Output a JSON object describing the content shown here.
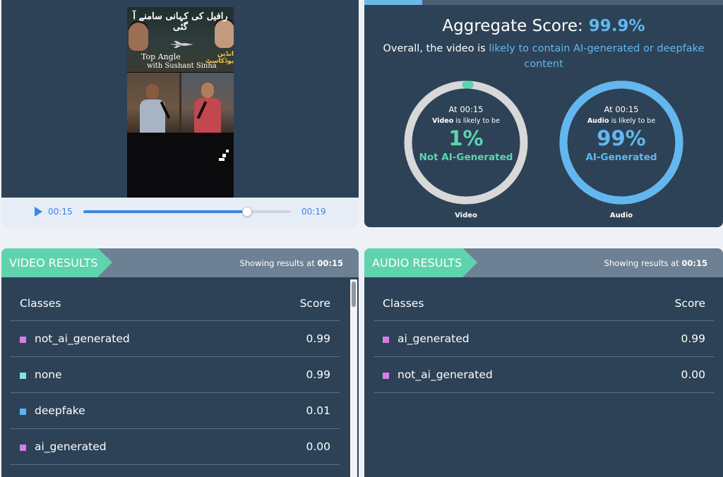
{
  "player": {
    "thumbnail": {
      "urdu_title": "رافیل کی کہانی سامنے آ گئی",
      "show_name": "Top Angle",
      "urdu_sub": "انڈین پوڈکاسٹ",
      "host": "with Sushant Sinha"
    },
    "current_time": "00:15",
    "total_time": "00:19",
    "progress": 0.79
  },
  "aggregate": {
    "title_label": "Aggregate Score:",
    "score": "99.9%",
    "desc_prefix": "Overall, the video is",
    "desc_highlight": "likely to contain AI-generated or deepfake content",
    "gauges": [
      {
        "time": "At 00:15",
        "modality": "Video",
        "likely_text": "is likely to be",
        "percent": "1%",
        "value": 0.01,
        "verdict": "Not AI-Generated",
        "verdict_color": "#5fd3ad",
        "caption": "Video"
      },
      {
        "time": "At 00:15",
        "modality": "Audio",
        "likely_text": "is likely to be",
        "percent": "99%",
        "value": 0.99,
        "verdict": "AI-Generated",
        "verdict_color": "#62b7f0",
        "caption": "Audio"
      }
    ]
  },
  "video_results": {
    "title": "VIDEO RESULTS",
    "showing_prefix": "Showing results at",
    "showing_time": "00:15",
    "col_classes": "Classes",
    "col_score": "Score",
    "rows": [
      {
        "label": "not_ai_generated",
        "score": "0.99",
        "color": "#d37fe8"
      },
      {
        "label": "none",
        "score": "0.99",
        "color": "#7de8d6"
      },
      {
        "label": "deepfake",
        "score": "0.01",
        "color": "#5ab4f0"
      },
      {
        "label": "ai_generated",
        "score": "0.00",
        "color": "#d37fe8"
      }
    ]
  },
  "audio_results": {
    "title": "AUDIO RESULTS",
    "showing_prefix": "Showing results at",
    "showing_time": "00:15",
    "col_classes": "Classes",
    "col_score": "Score",
    "rows": [
      {
        "label": "ai_generated",
        "score": "0.99",
        "color": "#d37fe8"
      },
      {
        "label": "not_ai_generated",
        "score": "0.00",
        "color": "#d37fe8"
      }
    ]
  },
  "colors": {
    "accent_blue": "#3b86e6",
    "panel_bg": "#2d4256",
    "teal": "#5fd3ad",
    "light_blue": "#62b7f0"
  }
}
